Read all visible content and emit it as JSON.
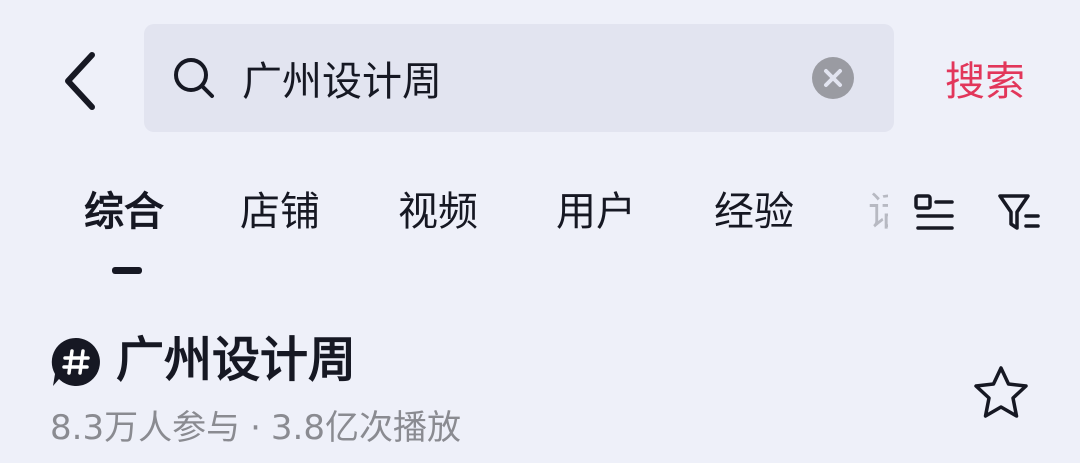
{
  "search": {
    "query": "广州设计周",
    "submit_label": "搜索"
  },
  "tabs": [
    {
      "label": "综合",
      "active": true
    },
    {
      "label": "店铺",
      "active": false
    },
    {
      "label": "视频",
      "active": false
    },
    {
      "label": "用户",
      "active": false
    },
    {
      "label": "经验",
      "active": false
    }
  ],
  "tabs_overflow_peek": "话",
  "topic": {
    "title": "广州设计周",
    "participants": "8.3万人参与",
    "separator": "·",
    "plays": "3.8亿次播放"
  },
  "icons": {
    "back": "chevron-left-icon",
    "search": "search-icon",
    "clear": "clear-circle-icon",
    "layout": "list-layout-icon",
    "filter": "filter-icon",
    "hashtag": "hashtag-icon",
    "favorite": "star-outline-icon"
  },
  "colors": {
    "background": "#EEF0F9",
    "search_box": "#E2E4F0",
    "accent": "#E2365A",
    "text_primary": "#161823",
    "text_secondary": "#8A8B91"
  }
}
